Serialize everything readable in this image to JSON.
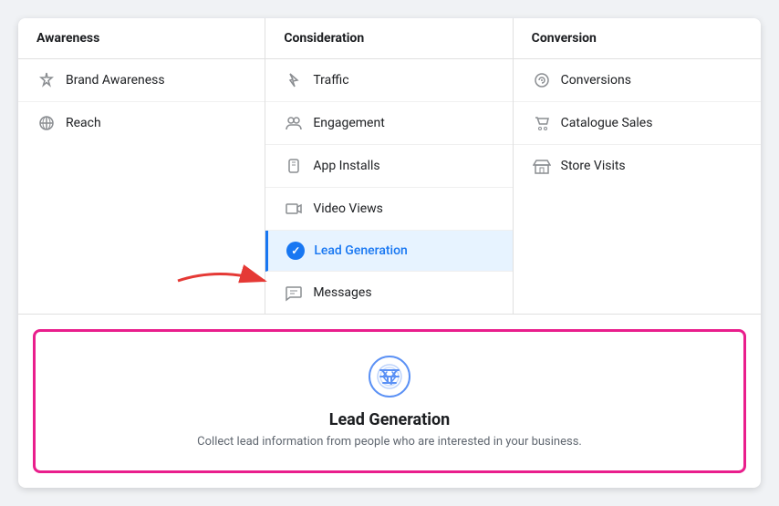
{
  "columns": [
    {
      "id": "awareness",
      "header": "Awareness",
      "items": [
        {
          "id": "brand-awareness",
          "label": "Brand Awareness",
          "icon": "pin"
        },
        {
          "id": "reach",
          "label": "Reach",
          "icon": "asterisk"
        }
      ]
    },
    {
      "id": "consideration",
      "header": "Consideration",
      "items": [
        {
          "id": "traffic",
          "label": "Traffic",
          "icon": "cursor"
        },
        {
          "id": "engagement",
          "label": "Engagement",
          "icon": "people"
        },
        {
          "id": "app-installs",
          "label": "App Installs",
          "icon": "box"
        },
        {
          "id": "video-views",
          "label": "Video Views",
          "icon": "video"
        },
        {
          "id": "lead-generation",
          "label": "Lead Generation",
          "icon": "check",
          "selected": true
        },
        {
          "id": "messages",
          "label": "Messages",
          "icon": "chat"
        }
      ]
    },
    {
      "id": "conversion",
      "header": "Conversion",
      "items": [
        {
          "id": "conversions",
          "label": "Conversions",
          "icon": "globe"
        },
        {
          "id": "catalogue-sales",
          "label": "Catalogue Sales",
          "icon": "cart"
        },
        {
          "id": "store-visits",
          "label": "Store Visits",
          "icon": "store"
        }
      ]
    }
  ],
  "detail": {
    "title": "Lead Generation",
    "description": "Collect lead information from people who are interested in your business."
  }
}
